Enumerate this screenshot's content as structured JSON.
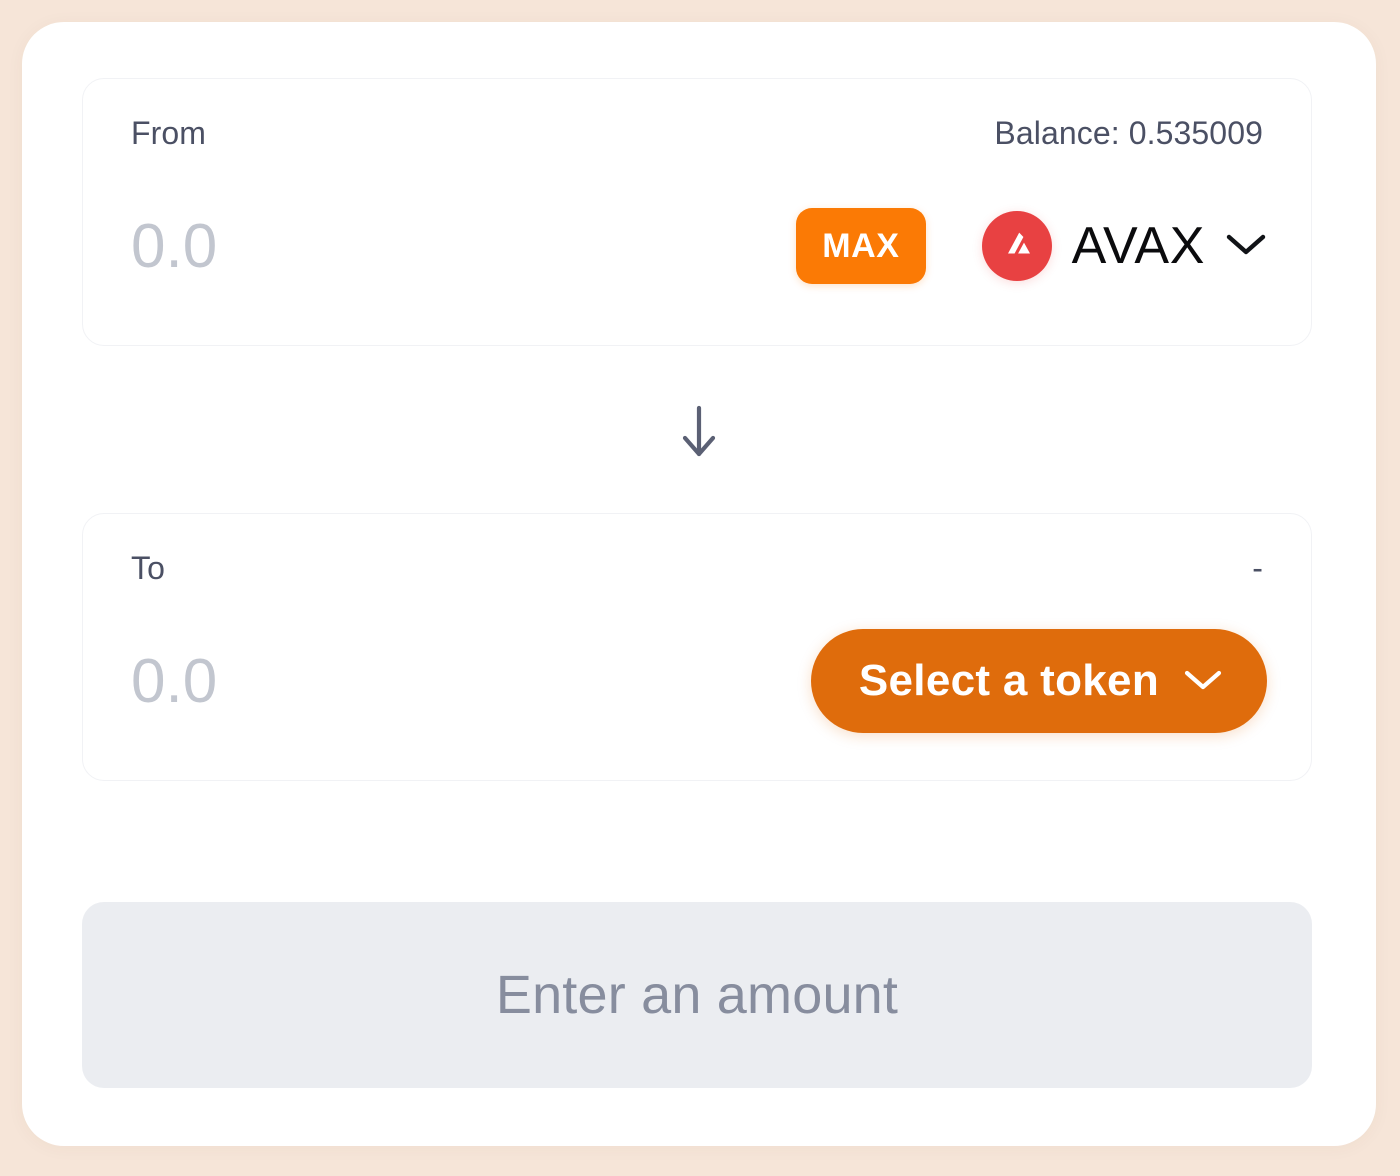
{
  "theme": {
    "page_background": "#f6e5d8",
    "card_background": "#ffffff",
    "accent_orange": "#fb7a05",
    "accent_orange_deep": "#df6c0c",
    "avax_red": "#e84142",
    "muted_text": "#4b5064",
    "placeholder_text": "#c2c6cf",
    "disabled_button_bg": "#ebedf1",
    "disabled_button_text": "#878d9e"
  },
  "from_panel": {
    "label": "From",
    "balance_text": "Balance: 0.535009",
    "amount_value": "",
    "amount_placeholder": "0.0",
    "max_label": "MAX",
    "token_symbol": "AVAX",
    "token_logo_icon": "avax-logo-icon",
    "chevron_icon": "chevron-down-icon"
  },
  "swap_direction": {
    "icon": "arrow-down-icon"
  },
  "to_panel": {
    "label": "To",
    "rate_text": "-",
    "amount_value": "",
    "amount_placeholder": "0.0",
    "select_token_label": "Select a token",
    "chevron_icon": "chevron-down-icon"
  },
  "primary_action": {
    "label": "Enter an amount",
    "disabled": true
  }
}
